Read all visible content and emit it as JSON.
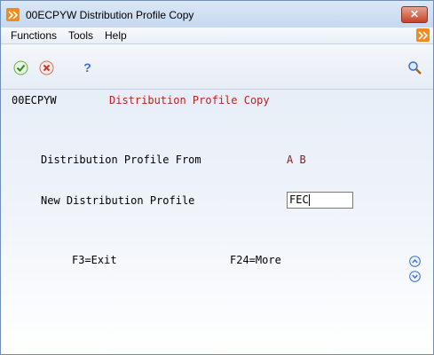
{
  "window": {
    "title": "00ECPYW   Distribution Profile Copy",
    "close_label": "✕"
  },
  "menu": {
    "items": [
      {
        "label": "Functions"
      },
      {
        "label": "Tools"
      },
      {
        "label": "Help"
      }
    ]
  },
  "toolbar": {
    "ok_icon": "checkmark-icon",
    "cancel_icon": "cancel-icon",
    "help_icon": "question-icon",
    "search_icon": "magnifier-icon"
  },
  "form": {
    "program_id": "00ECPYW",
    "form_title": "Distribution Profile Copy",
    "from_label": "Distribution Profile From",
    "from_value": "A B",
    "new_label": "New Distribution Profile",
    "new_value": "FEC",
    "f3_label": "F3=Exit",
    "f24_label": "F24=More"
  },
  "colors": {
    "accent_red": "#b3261e",
    "value_red": "#8b1b1b"
  }
}
